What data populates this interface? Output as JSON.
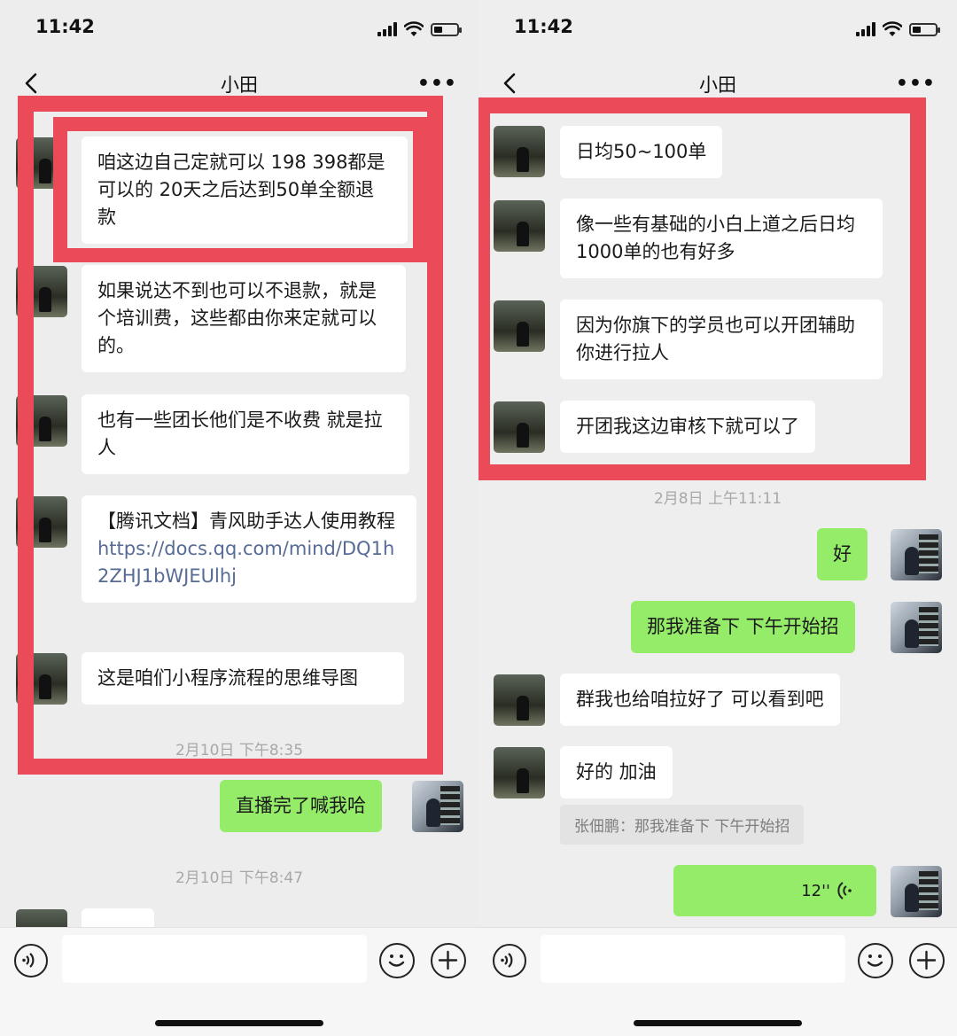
{
  "status": {
    "time": "11:42"
  },
  "left": {
    "title": "小田",
    "messages": [
      "咱这边自己定就可以 198 398都是可以的 20天之后达到50单全额退款",
      "如果说达不到也可以不退款，就是个培训费，这些都由你来定就可以的。",
      "也有一些团长他们是不收费 就是拉人",
      "【腾讯文档】青风助手达人使用教程",
      "https://docs.qq.com/mind/DQ1h2ZHJ1bWJEUlhj",
      "这是咱们小程序流程的思维导图"
    ],
    "timestamp_1": "2月10日 下午8:35",
    "sent_1": "直播完了喊我哈",
    "timestamp_2": "2月10日 下午8:47"
  },
  "right": {
    "title": "小田",
    "messages": [
      "日均50~100单",
      "像一些有基础的小白上道之后日均1000单的也有好多",
      "因为你旗下的学员也可以开团辅助你进行拉人",
      "开团我这边审核下就可以了"
    ],
    "timestamp_1": "2月8日 上午11:11",
    "sent_1": "好",
    "sent_2": "那我准备下 下午开始招",
    "received_1": "群我也给咱拉好了 可以看到吧",
    "received_2": "好的 加油",
    "quote": "张佃鹏：那我准备下 下午开始招",
    "voice_duration": "12''"
  },
  "colors": {
    "highlight": "#eb4a59",
    "sent_bubble": "#95ec69",
    "link": "#576b95"
  },
  "icons": [
    "back-icon",
    "more-icon",
    "voice-icon",
    "emoji-icon",
    "plus-icon",
    "signal-icon",
    "wifi-icon",
    "battery-icon"
  ]
}
